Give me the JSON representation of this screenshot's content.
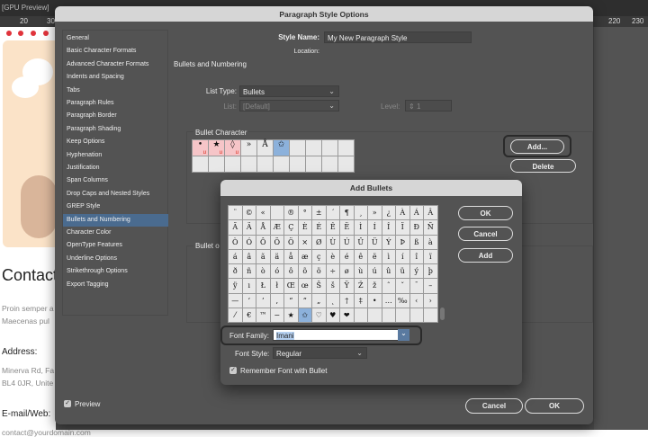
{
  "app": {
    "top_label": "[GPU Preview]",
    "ruler_ticks": [
      "20",
      "30",
      "220",
      "230"
    ]
  },
  "document": {
    "heading": "Contact",
    "para": [
      "Proin semper a",
      "Maecenas pul"
    ],
    "address_label": "Address:",
    "address": [
      "Minerva Rd, Fa",
      "BL4 0JR, Unite"
    ],
    "email_label": "E-mail/Web:",
    "email": "contact@yourdomain.com"
  },
  "dialog": {
    "title": "Paragraph Style Options",
    "sidebar": [
      "General",
      "Basic Character Formats",
      "Advanced Character Formats",
      "Indents and Spacing",
      "Tabs",
      "Paragraph Rules",
      "Paragraph Border",
      "Paragraph Shading",
      "Keep Options",
      "Hyphenation",
      "Justification",
      "Span Columns",
      "Drop Caps and Nested Styles",
      "GREP Style",
      "Bullets and Numbering",
      "Character Color",
      "OpenType Features",
      "Underline Options",
      "Strikethrough Options",
      "Export Tagging"
    ],
    "selected_index": 14,
    "style_name_label": "Style Name:",
    "style_name": "My New Paragraph Style",
    "location_label": "Location:",
    "section_title": "Bullets and Numbering",
    "list_type_label": "List Type:",
    "list_type": "Bullets",
    "list_label": "List:",
    "list": "[Default]",
    "level_label": "Level:",
    "level": "1",
    "bullet_char_label": "Bullet Character",
    "bullet_chars": [
      {
        "c": "•",
        "u": true
      },
      {
        "c": "★",
        "u": true
      },
      {
        "c": "◊",
        "u": true
      },
      {
        "c": "»"
      },
      {
        "c": "Å"
      },
      {
        "c": "✩",
        "selected": true
      }
    ],
    "add_label": "Add...",
    "delete_label": "Delete",
    "bullet_or_label": "Bullet o",
    "preview_label": "Preview",
    "preview_checked": true,
    "cancel_label": "Cancel",
    "ok_label": "OK"
  },
  "add_bullets": {
    "title": "Add Bullets",
    "glyph_rows": [
      [
        "¨",
        "©",
        "«",
        "",
        "®",
        "°",
        "±",
        "´",
        "¶",
        "¸",
        "»",
        "¿",
        "À",
        "Á",
        "Â"
      ],
      [
        "Ã",
        "Ä",
        "Å",
        "Æ",
        "Ç",
        "È",
        "É",
        "Ê",
        "Ë",
        "Ì",
        "Í",
        "Î",
        "Ï",
        "Ð",
        "Ñ"
      ],
      [
        "Ò",
        "Ó",
        "Ô",
        "Õ",
        "Ö",
        "×",
        "Ø",
        "Ù",
        "Ú",
        "Û",
        "Ü",
        "Ý",
        "Þ",
        "ß",
        "à"
      ],
      [
        "á",
        "â",
        "ã",
        "ä",
        "å",
        "æ",
        "ç",
        "è",
        "é",
        "ê",
        "ë",
        "ì",
        "í",
        "î",
        "ï"
      ],
      [
        "ð",
        "ñ",
        "ò",
        "ó",
        "ô",
        "õ",
        "ö",
        "÷",
        "ø",
        "ù",
        "ú",
        "û",
        "ü",
        "ý",
        "þ"
      ],
      [
        "ÿ",
        "ı",
        "Ł",
        "ł",
        "Œ",
        "œ",
        "Š",
        "š",
        "Ÿ",
        "Ž",
        "ž",
        "ˆ",
        "ˇ",
        "¯",
        "–"
      ],
      [
        "—",
        "‘",
        "’",
        "‚",
        "“",
        "”",
        "„",
        "˛",
        "†",
        "‡",
        "•",
        "…",
        "‰",
        "‹",
        "›"
      ],
      [
        "⁄",
        "€",
        "™",
        "−",
        "★",
        "✩",
        "♡",
        "♥",
        "❤",
        "",
        "",
        "",
        "",
        "",
        ""
      ]
    ],
    "selected_glyph": "✩",
    "ok_label": "OK",
    "cancel_label": "Cancel",
    "add_label": "Add",
    "font_family_label": "Font Family:",
    "font_family": "Imani",
    "font_style_label": "Font Style:",
    "font_style": "Regular",
    "remember_label": "Remember Font with Bullet",
    "remember_checked": true
  },
  "colors": {
    "selection": "#4a6b8f",
    "glyph_selected": "#8cb1db",
    "bullet_underline": "#d21111",
    "dialog_bg": "#535353"
  }
}
